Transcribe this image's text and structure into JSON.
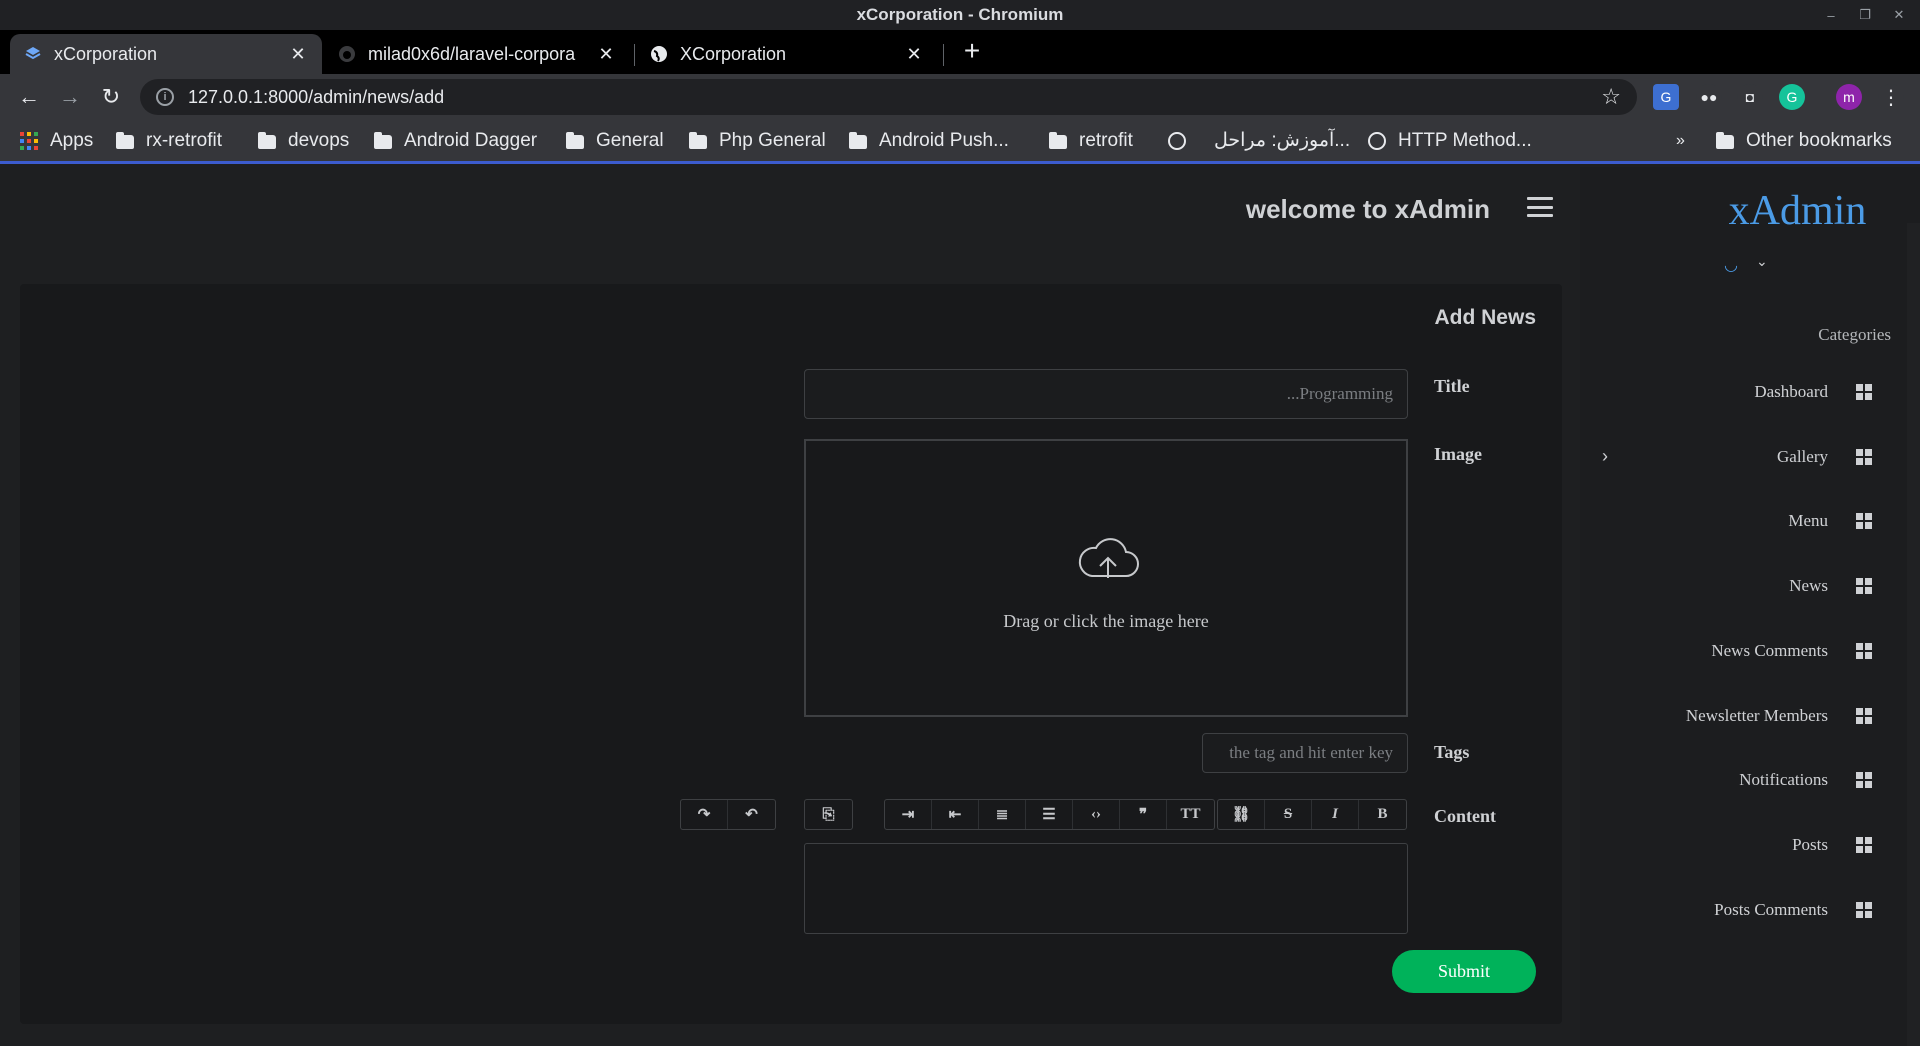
{
  "window": {
    "title": "xCorporation - Chromium",
    "controls": [
      "–",
      "❐",
      "✕"
    ]
  },
  "tabs": [
    {
      "label": "xCorporation",
      "active": true
    },
    {
      "label": "milad0x6d/laravel-corpora",
      "active": false
    },
    {
      "label": "XCorporation",
      "active": false
    }
  ],
  "toolbar": {
    "url": "127.0.0.1:8000/admin/news/add",
    "new_tab": "+"
  },
  "bookmarks": {
    "items": [
      "Apps",
      "rx-retrofit",
      "devops",
      "Android Dagger",
      "General",
      "Php General",
      "Android Push...",
      "retrofit",
      "آموزش: مراحل...",
      "HTTP Method..."
    ],
    "overflow": "»",
    "other": "Other bookmarks"
  },
  "header": {
    "welcome": "welcome to xAdmin"
  },
  "form": {
    "title": "Add News",
    "fields": {
      "title_label": "Title",
      "title_placeholder": "...Programming",
      "image_label": "Image",
      "image_hint": "Drag or click the image here",
      "tags_label": "Tags",
      "tags_placeholder": "the tag and hit enter key",
      "content_label": "Content"
    },
    "submit": "Submit"
  },
  "sidebar": {
    "brand": "xAdmin",
    "section_title": "Categories",
    "items": [
      "Dashboard",
      "Gallery",
      "Menu",
      "News",
      "News Comments",
      "Newsletter Members",
      "Notifications",
      "Posts",
      "Posts Comments"
    ],
    "expander": "›"
  },
  "colors": {
    "accent": "#4b9be6",
    "submit": "#00b25a",
    "bookmark_border": "#3c5ccf"
  }
}
